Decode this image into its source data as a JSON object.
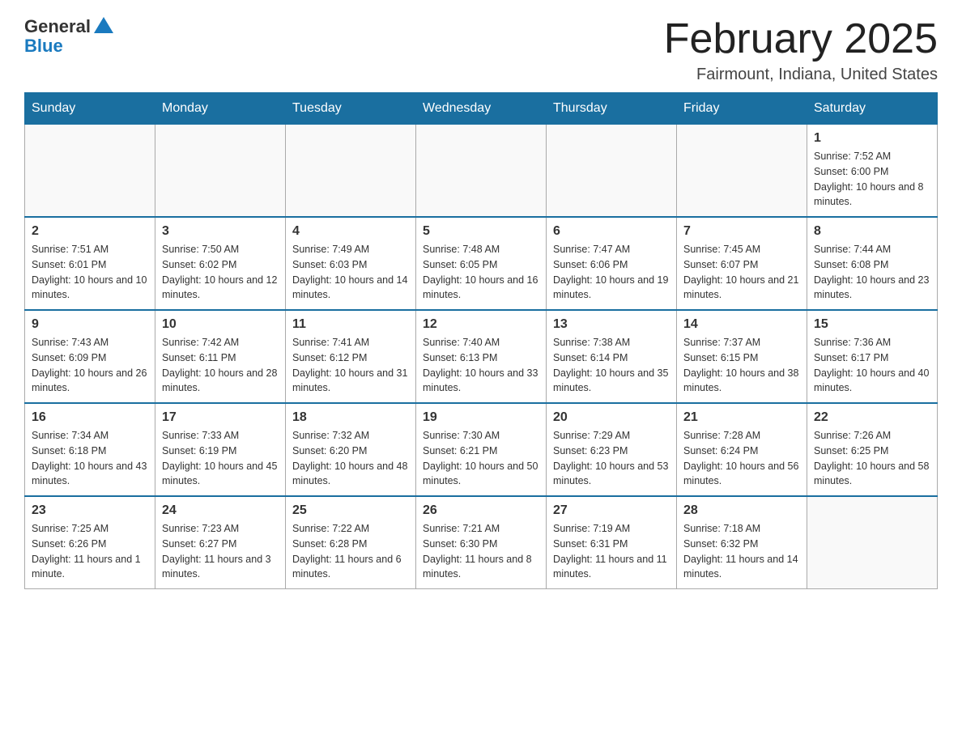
{
  "header": {
    "logo_general": "General",
    "logo_blue": "Blue",
    "month_title": "February 2025",
    "location": "Fairmount, Indiana, United States"
  },
  "weekdays": [
    "Sunday",
    "Monday",
    "Tuesday",
    "Wednesday",
    "Thursday",
    "Friday",
    "Saturday"
  ],
  "weeks": [
    [
      {
        "day": "",
        "info": ""
      },
      {
        "day": "",
        "info": ""
      },
      {
        "day": "",
        "info": ""
      },
      {
        "day": "",
        "info": ""
      },
      {
        "day": "",
        "info": ""
      },
      {
        "day": "",
        "info": ""
      },
      {
        "day": "1",
        "info": "Sunrise: 7:52 AM\nSunset: 6:00 PM\nDaylight: 10 hours and 8 minutes."
      }
    ],
    [
      {
        "day": "2",
        "info": "Sunrise: 7:51 AM\nSunset: 6:01 PM\nDaylight: 10 hours and 10 minutes."
      },
      {
        "day": "3",
        "info": "Sunrise: 7:50 AM\nSunset: 6:02 PM\nDaylight: 10 hours and 12 minutes."
      },
      {
        "day": "4",
        "info": "Sunrise: 7:49 AM\nSunset: 6:03 PM\nDaylight: 10 hours and 14 minutes."
      },
      {
        "day": "5",
        "info": "Sunrise: 7:48 AM\nSunset: 6:05 PM\nDaylight: 10 hours and 16 minutes."
      },
      {
        "day": "6",
        "info": "Sunrise: 7:47 AM\nSunset: 6:06 PM\nDaylight: 10 hours and 19 minutes."
      },
      {
        "day": "7",
        "info": "Sunrise: 7:45 AM\nSunset: 6:07 PM\nDaylight: 10 hours and 21 minutes."
      },
      {
        "day": "8",
        "info": "Sunrise: 7:44 AM\nSunset: 6:08 PM\nDaylight: 10 hours and 23 minutes."
      }
    ],
    [
      {
        "day": "9",
        "info": "Sunrise: 7:43 AM\nSunset: 6:09 PM\nDaylight: 10 hours and 26 minutes."
      },
      {
        "day": "10",
        "info": "Sunrise: 7:42 AM\nSunset: 6:11 PM\nDaylight: 10 hours and 28 minutes."
      },
      {
        "day": "11",
        "info": "Sunrise: 7:41 AM\nSunset: 6:12 PM\nDaylight: 10 hours and 31 minutes."
      },
      {
        "day": "12",
        "info": "Sunrise: 7:40 AM\nSunset: 6:13 PM\nDaylight: 10 hours and 33 minutes."
      },
      {
        "day": "13",
        "info": "Sunrise: 7:38 AM\nSunset: 6:14 PM\nDaylight: 10 hours and 35 minutes."
      },
      {
        "day": "14",
        "info": "Sunrise: 7:37 AM\nSunset: 6:15 PM\nDaylight: 10 hours and 38 minutes."
      },
      {
        "day": "15",
        "info": "Sunrise: 7:36 AM\nSunset: 6:17 PM\nDaylight: 10 hours and 40 minutes."
      }
    ],
    [
      {
        "day": "16",
        "info": "Sunrise: 7:34 AM\nSunset: 6:18 PM\nDaylight: 10 hours and 43 minutes."
      },
      {
        "day": "17",
        "info": "Sunrise: 7:33 AM\nSunset: 6:19 PM\nDaylight: 10 hours and 45 minutes."
      },
      {
        "day": "18",
        "info": "Sunrise: 7:32 AM\nSunset: 6:20 PM\nDaylight: 10 hours and 48 minutes."
      },
      {
        "day": "19",
        "info": "Sunrise: 7:30 AM\nSunset: 6:21 PM\nDaylight: 10 hours and 50 minutes."
      },
      {
        "day": "20",
        "info": "Sunrise: 7:29 AM\nSunset: 6:23 PM\nDaylight: 10 hours and 53 minutes."
      },
      {
        "day": "21",
        "info": "Sunrise: 7:28 AM\nSunset: 6:24 PM\nDaylight: 10 hours and 56 minutes."
      },
      {
        "day": "22",
        "info": "Sunrise: 7:26 AM\nSunset: 6:25 PM\nDaylight: 10 hours and 58 minutes."
      }
    ],
    [
      {
        "day": "23",
        "info": "Sunrise: 7:25 AM\nSunset: 6:26 PM\nDaylight: 11 hours and 1 minute."
      },
      {
        "day": "24",
        "info": "Sunrise: 7:23 AM\nSunset: 6:27 PM\nDaylight: 11 hours and 3 minutes."
      },
      {
        "day": "25",
        "info": "Sunrise: 7:22 AM\nSunset: 6:28 PM\nDaylight: 11 hours and 6 minutes."
      },
      {
        "day": "26",
        "info": "Sunrise: 7:21 AM\nSunset: 6:30 PM\nDaylight: 11 hours and 8 minutes."
      },
      {
        "day": "27",
        "info": "Sunrise: 7:19 AM\nSunset: 6:31 PM\nDaylight: 11 hours and 11 minutes."
      },
      {
        "day": "28",
        "info": "Sunrise: 7:18 AM\nSunset: 6:32 PM\nDaylight: 11 hours and 14 minutes."
      },
      {
        "day": "",
        "info": ""
      }
    ]
  ]
}
